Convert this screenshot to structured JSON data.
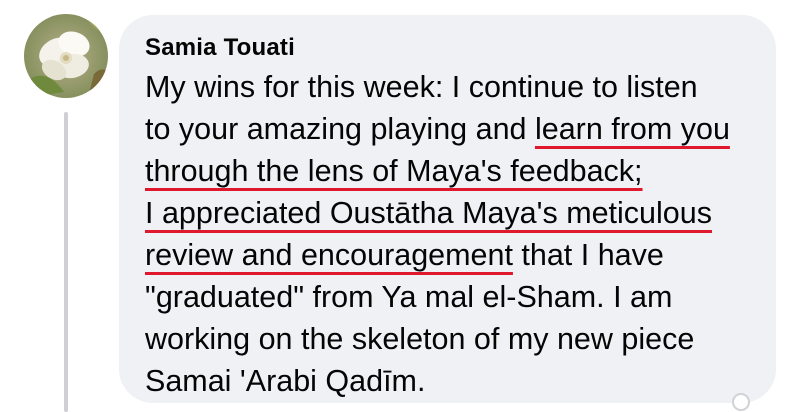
{
  "comment": {
    "author": "Samia Touati",
    "avatar_icon": "white-flower-avatar",
    "annotation_color": "#e0182d",
    "lines": [
      [
        {
          "text": "My wins for this week: I continue to listen",
          "highlight": false
        }
      ],
      [
        {
          "text": "to your amazing playing and ",
          "highlight": false
        },
        {
          "text": "learn from you",
          "highlight": true
        }
      ],
      [
        {
          "text": "through the lens of Maya's feedback;",
          "highlight": true
        }
      ],
      [
        {
          "text": "I appreciated Oustātha Maya's meticulous",
          "highlight": true
        }
      ],
      [
        {
          "text": "review and encouragement",
          "highlight": true
        },
        {
          "text": " that I have",
          "highlight": false
        }
      ],
      [
        {
          "text": "\"graduated\" from Ya mal el-Sham. I am",
          "highlight": false
        }
      ],
      [
        {
          "text": "working on the skeleton of my new piece",
          "highlight": false
        }
      ],
      [
        {
          "text": "Samai 'Arabi Qadīm.",
          "highlight": false
        }
      ]
    ]
  }
}
